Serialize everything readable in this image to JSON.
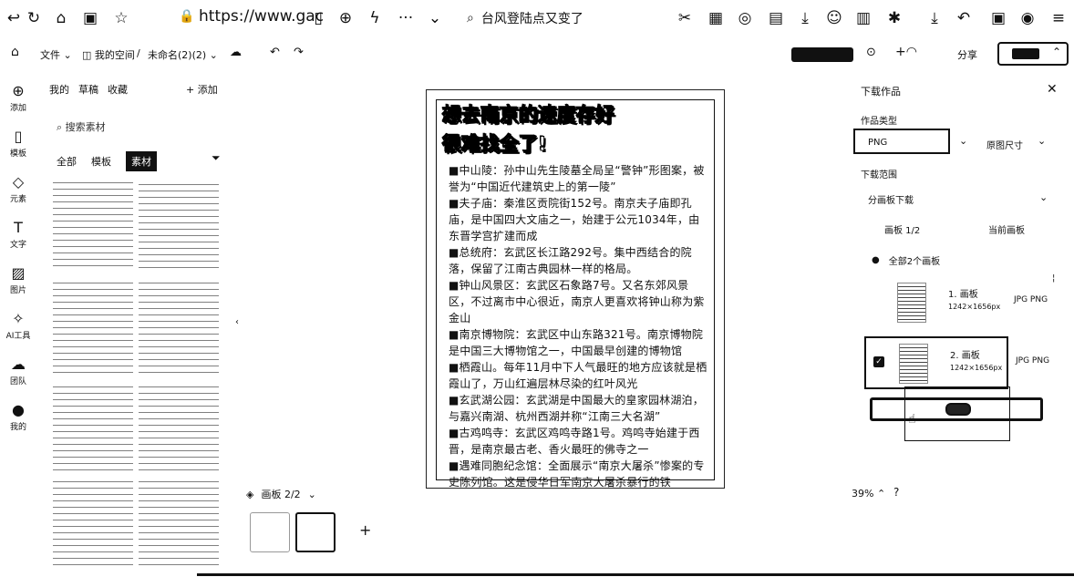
{
  "browser": {
    "url": "https://www.gac",
    "news_search": "台风登陆点又变了"
  },
  "toolbar": {
    "file_menu": "文件",
    "breadcrumb_space": "我的空间",
    "breadcrumb_sep": "/",
    "doc_name": "未命名(2)(2)",
    "share": "分享"
  },
  "rail": [
    {
      "icon": "add-icon",
      "glyph": "⊕",
      "label": "添加"
    },
    {
      "icon": "template-icon",
      "glyph": "▯",
      "label": "模板"
    },
    {
      "icon": "element-icon",
      "glyph": "◇",
      "label": "元素"
    },
    {
      "icon": "text-icon",
      "glyph": "T",
      "label": "文字"
    },
    {
      "icon": "image-icon",
      "glyph": "▨",
      "label": "图片"
    },
    {
      "icon": "ai-tool-icon",
      "glyph": "✧",
      "label": "AI工具"
    },
    {
      "icon": "team-icon",
      "glyph": "☁",
      "label": "团队"
    },
    {
      "icon": "profile-icon",
      "glyph": "●",
      "label": "我的"
    }
  ],
  "assets": {
    "tabs": [
      "我的",
      "草稿",
      "收藏"
    ],
    "add_label": "+ 添加",
    "search_placeholder": "搜索素材",
    "filters": [
      "全部",
      "模板",
      "素材"
    ],
    "active_filter": "素材"
  },
  "poster": {
    "title_line1": "想去南京的速度存好",
    "title_line2": "很难找全了!",
    "paragraphs": [
      "■中山陵：孙中山先生陵墓全局呈“警钟”形图案，被誉为“中国近代建筑史上的第一陵”",
      "■夫子庙：秦淮区贡院街152号。南京夫子庙即孔庙，是中国四大文庙之一，始建于公元1034年，由东晋学宫扩建而成",
      "■总统府：玄武区长江路292号。集中西结合的院落，保留了江南古典园林一样的格局。",
      "■钟山风景区：玄武区石象路7号。又名东郊风景区，不过离市中心很近，南京人更喜欢将钟山称为紫金山",
      "■南京博物院：玄武区中山东路321号。南京博物院是中国三大博物馆之一，中国最早创建的博物馆",
      "■栖霞山。每年11月中下人气最旺的地方应该就是栖霞山了，万山红遍层林尽染的红叶风光",
      "■玄武湖公园：玄武湖是中国最大的皇家园林湖泊，与嘉兴南湖、杭州西湖并称“江南三大名湖”",
      "■古鸡鸣寺：玄武区鸡鸣寺路1号。鸡鸣寺始建于西晋，是南京最古老、香火最旺的佛寺之一",
      "■遇难同胞纪念馆：全面展示“南京大屠杀”惨案的专史陈列馆。这是侵华日军南京大屠杀暴行的铁"
    ]
  },
  "board_bar": {
    "switch_label": "画板 2/2",
    "add_page": "+"
  },
  "zoom": "39%",
  "help": "?",
  "download_panel": {
    "title": "下载作品",
    "type_label": "作品类型",
    "type_value": "PNG",
    "size_value": "原图尺寸",
    "range_label": "下载范围",
    "range_value": "分画板下载",
    "pager": "画板 1/2",
    "current_board": "当前画板",
    "all_boards": "全部2个画板",
    "boards": [
      {
        "name": "1. 画板",
        "dims": "1242×1656px",
        "format": "JPG PNG"
      },
      {
        "name": "2. 画板",
        "dims": "1242×1656px",
        "format": "JPG PNG"
      }
    ]
  }
}
